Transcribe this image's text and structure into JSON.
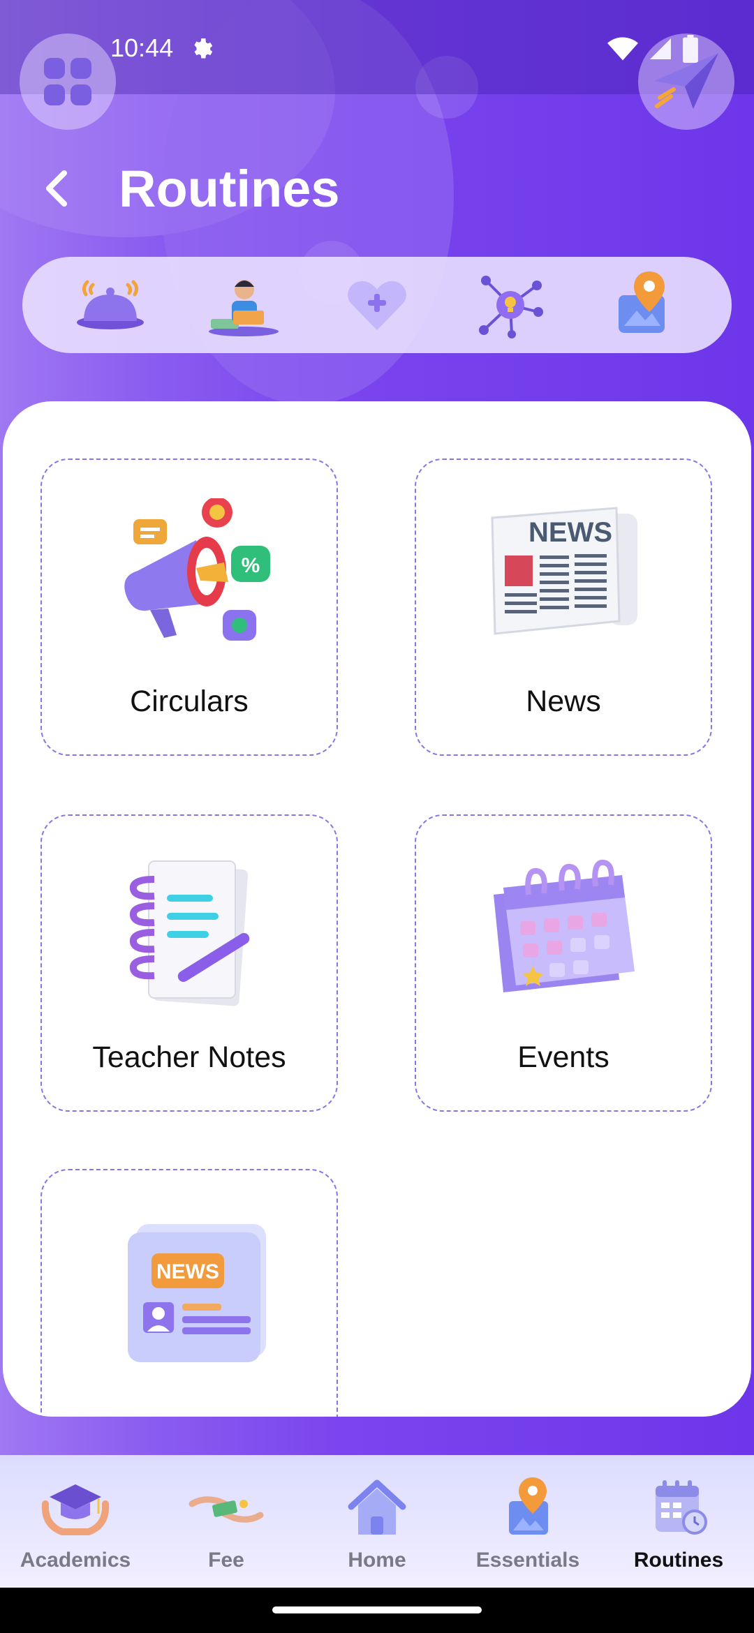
{
  "status_bar": {
    "time": "10:44"
  },
  "header": {
    "title": "Routines"
  },
  "quick_actions": [
    {
      "icon": "bell-icon"
    },
    {
      "icon": "teacher-desk-icon"
    },
    {
      "icon": "heart-health-icon"
    },
    {
      "icon": "network-idea-icon"
    },
    {
      "icon": "map-location-icon"
    }
  ],
  "tiles": [
    {
      "label": "Circulars",
      "icon": "megaphone-icon"
    },
    {
      "label": "News",
      "icon": "newspaper-icon"
    },
    {
      "label": "Teacher Notes",
      "icon": "notebook-icon"
    },
    {
      "label": "Events",
      "icon": "calendar-icon"
    },
    {
      "label": "",
      "icon": "news-bulletin-icon",
      "badge_text": "NEWS"
    }
  ],
  "bottom_nav": [
    {
      "label": "Academics",
      "icon": "graduation-cap-icon",
      "active": false
    },
    {
      "label": "Fee",
      "icon": "fee-payment-icon",
      "active": false
    },
    {
      "label": "Home",
      "icon": "home-icon",
      "active": false
    },
    {
      "label": "Essentials",
      "icon": "essentials-map-icon",
      "active": false
    },
    {
      "label": "Routines",
      "icon": "routines-calendar-icon",
      "active": true
    }
  ],
  "colors": {
    "primary_purple": "#7a45ee",
    "tile_border": "#8b73e3",
    "nav_active": "#111111",
    "nav_inactive": "#7a7a86"
  }
}
